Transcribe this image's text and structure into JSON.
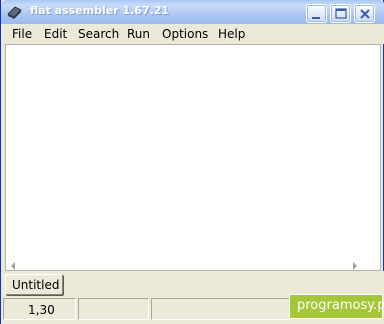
{
  "window": {
    "title": "flat assembler 1.67.21"
  },
  "menu": {
    "items": [
      "File",
      "Edit",
      "Search",
      "Run",
      "Options",
      "Help"
    ]
  },
  "tabs": [
    {
      "label": "Untitled",
      "active": true
    }
  ],
  "status": {
    "position": "1,30",
    "pane2": "",
    "pane3": ""
  },
  "watermark": {
    "text": "programosy.pl",
    "color": "#a4c639"
  },
  "colors": {
    "titlebar_accent": "#a9c7f6",
    "window_bg": "#ece9d8",
    "editor_bg": "#ffffff"
  },
  "icons": {
    "app": "fasm-app-icon",
    "minimize": "minimize-icon",
    "maximize": "maximize-icon",
    "close": "close-icon"
  }
}
